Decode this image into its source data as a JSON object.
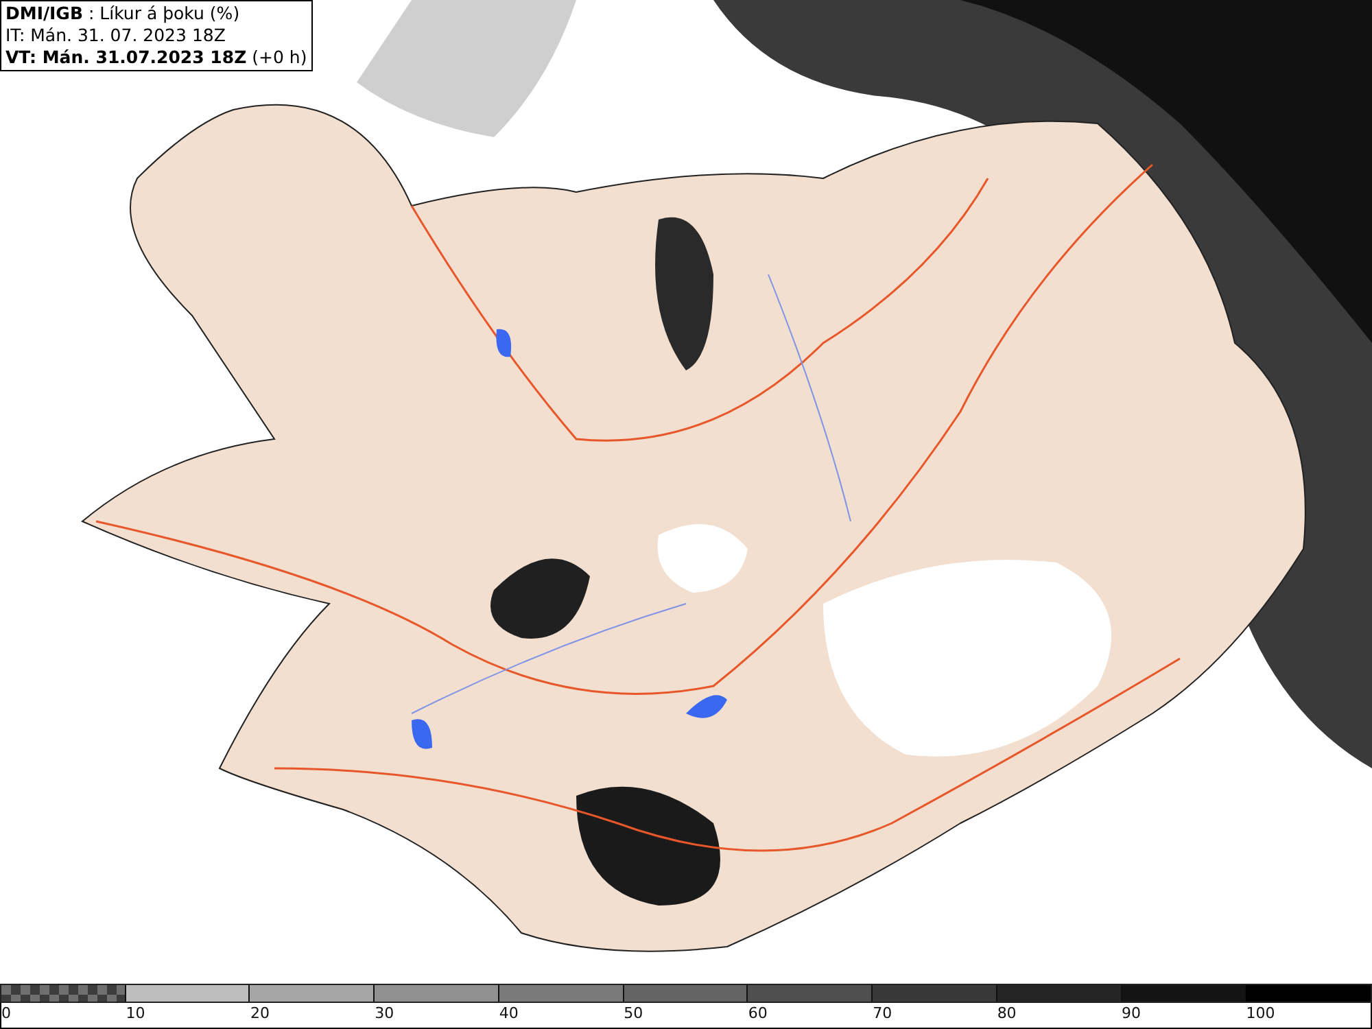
{
  "header": {
    "lines": [
      "**DMI/IGB** : Líkur á þoku (%)",
      "IT: Mán. 31. 07. 2023 18Z",
      "**VT: Mán. 31.07.2023 18Z** (+0 h)"
    ]
  },
  "legend": {
    "segments": [
      {
        "kind": "checker",
        "color": "#6f6f6f"
      },
      {
        "kind": "solid",
        "color": "#bdbdbd"
      },
      {
        "kind": "solid",
        "color": "#a6a6a6"
      },
      {
        "kind": "solid",
        "color": "#909090"
      },
      {
        "kind": "solid",
        "color": "#7a7a7a"
      },
      {
        "kind": "solid",
        "color": "#646464"
      },
      {
        "kind": "solid",
        "color": "#4e4e4e"
      },
      {
        "kind": "solid",
        "color": "#383838"
      },
      {
        "kind": "solid",
        "color": "#252525"
      },
      {
        "kind": "solid",
        "color": "#141414"
      },
      {
        "kind": "solid",
        "color": "#000000"
      }
    ],
    "labels": [
      "0",
      "10",
      "20",
      "30",
      "40",
      "50",
      "60",
      "70",
      "80",
      "90",
      "100"
    ]
  }
}
